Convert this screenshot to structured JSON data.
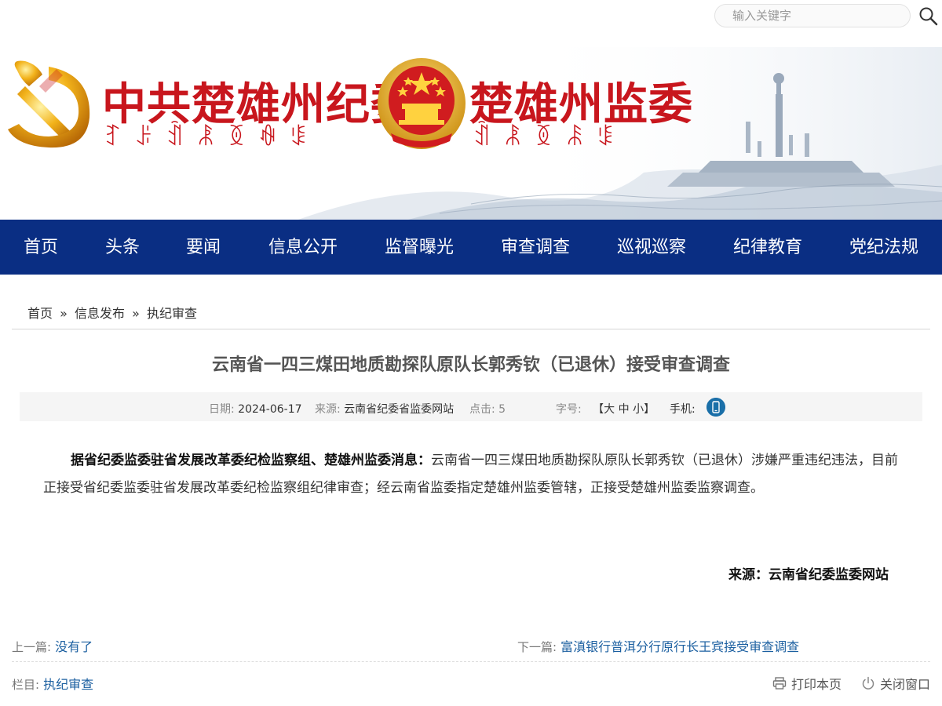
{
  "header": {
    "brand_left": "中共楚雄州纪委",
    "brand_right": "楚雄州监委",
    "yi_left": "ꆈꌠꀉꂿꅉꊿꌐ",
    "yi_right": "ꀉꂿꅉꄯꌐ",
    "search_placeholder": "输入关键字"
  },
  "nav": {
    "items": [
      {
        "label": "首页"
      },
      {
        "label": "头条"
      },
      {
        "label": "要闻"
      },
      {
        "label": "信息公开"
      },
      {
        "label": "监督曝光"
      },
      {
        "label": "审查调查"
      },
      {
        "label": "巡视巡察"
      },
      {
        "label": "纪律教育"
      },
      {
        "label": "党纪法规"
      }
    ]
  },
  "breadcrumb": {
    "items": [
      "首页",
      "信息发布",
      "执纪审查"
    ],
    "separator": "»"
  },
  "article": {
    "title": "云南省一四三煤田地质勘探队原队长郭秀钦（已退休）接受审查调查",
    "meta": {
      "date_label": "日期:",
      "date": "2024-06-17",
      "source_label": "来源:",
      "source": "云南省纪委省监委网站",
      "clicks_label": "点击:",
      "clicks": "5",
      "font_label": "字号:",
      "font_open": "【",
      "font_large": "大",
      "font_medium": "中",
      "font_small": "小",
      "font_close": "】",
      "mobile_label": "手机:"
    },
    "lead": "据省纪委监委驻省发展改革委纪检监察组、楚雄州监委消息：",
    "body": "云南省一四三煤田地质勘探队原队长郭秀钦（已退休）涉嫌严重违纪违法，目前正接受省纪委监委驻省发展改革委纪检监察组纪律审查；经云南省监委指定楚雄州监委管辖，正接受楚雄州监委监察调查。",
    "source_line": "来源：云南省纪委监委网站"
  },
  "pager": {
    "prev_label": "上一篇:",
    "prev_title": "没有了",
    "next_label": "下一篇:",
    "next_title": "富滇银行普洱分行原行长王宾接受审查调查"
  },
  "footer": {
    "column_label": "栏目:",
    "column_name": "执纪审查",
    "print_label": "打印本页",
    "close_label": "关闭窗口"
  },
  "colors": {
    "nav_bg": "#0a2e83",
    "brand_red": "#c8161d",
    "link_blue": "#1b5fa0"
  }
}
